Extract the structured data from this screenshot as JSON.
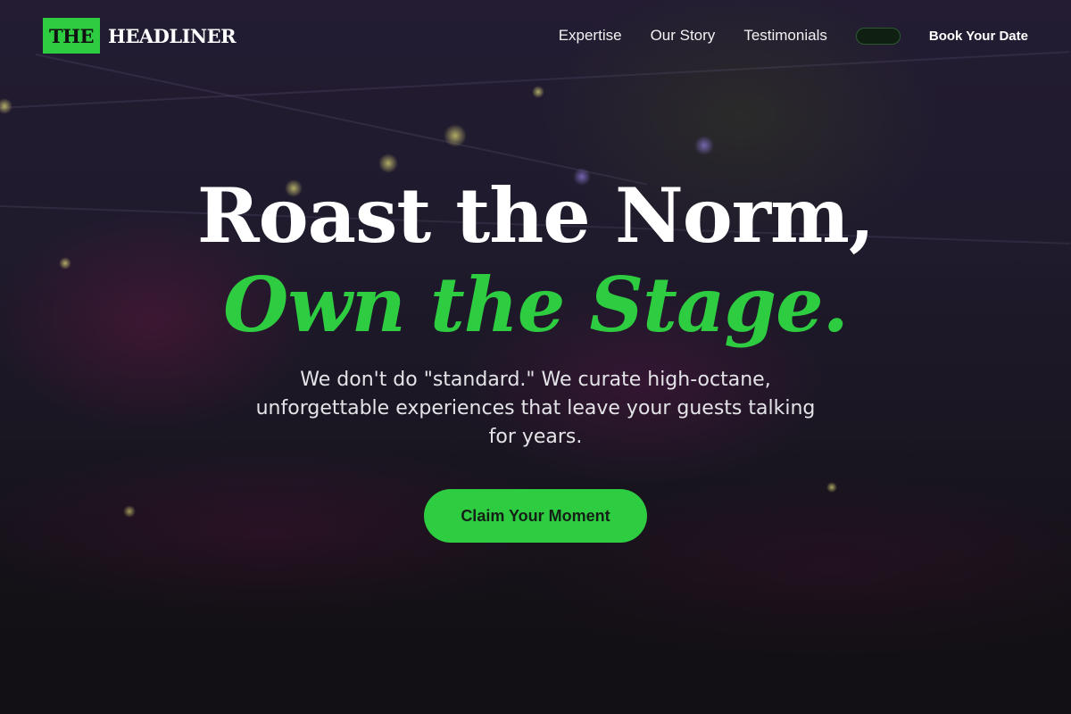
{
  "brand": {
    "mark": "THE",
    "word": "HEADLINER"
  },
  "nav": {
    "links": [
      {
        "label": "Expertise"
      },
      {
        "label": "Our Story"
      },
      {
        "label": "Testimonials"
      }
    ],
    "cta_label": "Book Your Date"
  },
  "hero": {
    "headline_line1": "Roast the Norm,",
    "headline_line2": "Own the Stage.",
    "subtext": "We don't do \"standard.\" We curate high-octane, unforgettable experiences that leave your guests talking for years.",
    "cta_label": "Claim Your Moment"
  },
  "colors": {
    "accent": "#2ecc40",
    "background": "#1a1622",
    "text": "#ffffff"
  }
}
